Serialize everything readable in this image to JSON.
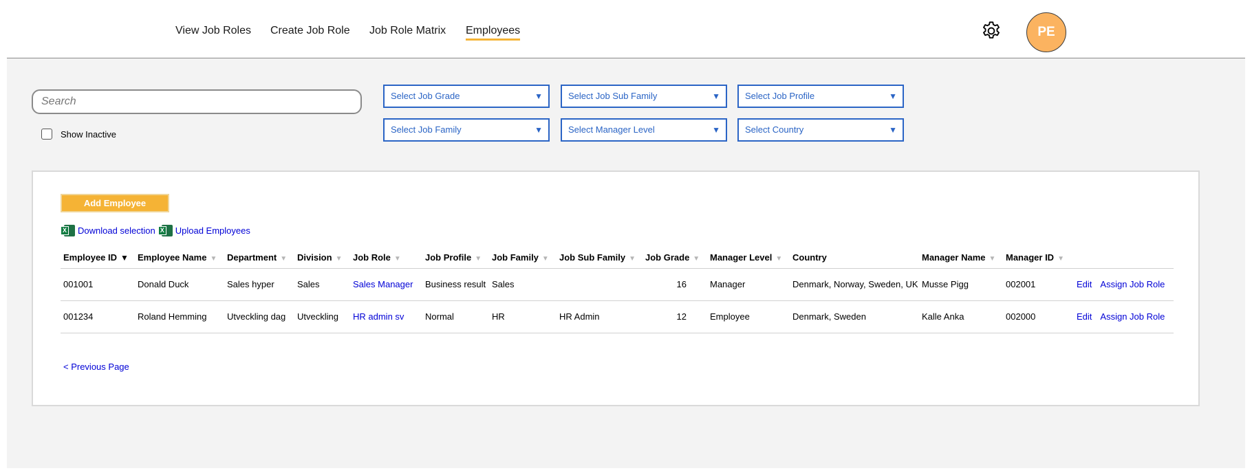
{
  "nav": {
    "items": [
      {
        "label": "View Job Roles"
      },
      {
        "label": "Create Job Role"
      },
      {
        "label": "Job Role Matrix"
      },
      {
        "label": "Employees",
        "active": true
      }
    ],
    "avatar_initials": "PE",
    "settings_icon": "gear-icon"
  },
  "filters": {
    "search_placeholder": "Search",
    "show_inactive_label": "Show Inactive",
    "show_inactive_checked": false,
    "job_grade": "Select Job Grade",
    "job_sub_family": "Select Job Sub Family",
    "job_profile": "Select Job Profile",
    "job_family": "Select Job Family",
    "manager_level": "Select Manager Level",
    "country": "Select Country"
  },
  "actions": {
    "add_employee": "Add Employee",
    "download_selection": "Download selection",
    "upload_employees": "Upload Employees",
    "excel_icon": "excel-icon"
  },
  "table": {
    "columns": [
      "Employee ID",
      "Employee Name",
      "Department",
      "Division",
      "Job Role",
      "Job Profile",
      "Job Family",
      "Job Sub Family",
      "Job Grade",
      "Manager Level",
      "Country",
      "Manager Name",
      "Manager ID"
    ],
    "rows": [
      {
        "employee_id": "001001",
        "employee_name": "Donald Duck",
        "department": "Sales hyper",
        "division": "Sales",
        "job_role": "Sales Manager",
        "job_profile": "Business result",
        "job_family": "Sales",
        "job_sub_family": "",
        "job_grade": "16",
        "manager_level": "Manager",
        "country": "Denmark, Norway, Sweden, UK",
        "manager_name": "Musse Pigg",
        "manager_id": "002001",
        "edit": "Edit",
        "assign": "Assign Job Role"
      },
      {
        "employee_id": "001234",
        "employee_name": "Roland Hemming",
        "department": "Utveckling dag",
        "division": "Utveckling",
        "job_role": "HR admin sv",
        "job_profile": "Normal",
        "job_family": "HR",
        "job_sub_family": "HR Admin",
        "job_grade": "12",
        "manager_level": "Employee",
        "country": "Denmark, Sweden",
        "manager_name": "Kalle Anka",
        "manager_id": "002000",
        "edit": "Edit",
        "assign": "Assign Job Role"
      }
    ],
    "sort_arrow": "▼"
  },
  "pagination": {
    "previous": "< Previous Page"
  },
  "colors": {
    "accent": "#f5b335",
    "select_border": "#2a64c5",
    "link": "#0000d6",
    "avatar_bg": "#fbb360"
  }
}
